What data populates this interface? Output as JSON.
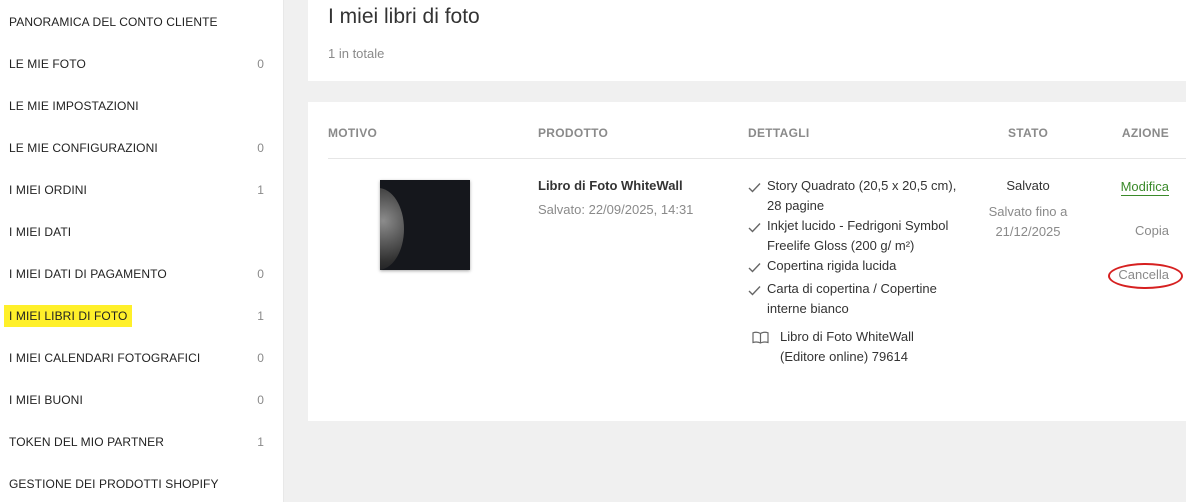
{
  "sidebar": {
    "items": [
      {
        "label": "PANORAMICA DEL CONTO CLIENTE",
        "count": ""
      },
      {
        "label": "LE MIE FOTO",
        "count": "0"
      },
      {
        "label": "LE MIE IMPOSTAZIONI",
        "count": ""
      },
      {
        "label": "LE MIE CONFIGURAZIONI",
        "count": "0"
      },
      {
        "label": "I MIEI ORDINI",
        "count": "1"
      },
      {
        "label": "I MIEI DATI",
        "count": ""
      },
      {
        "label": "I MIEI DATI DI PAGAMENTO",
        "count": "0"
      },
      {
        "label": "I MIEI LIBRI DI FOTO",
        "count": "1",
        "highlighted": true
      },
      {
        "label": "I MIEI CALENDARI FOTOGRAFICI",
        "count": "0"
      },
      {
        "label": "I MIEI BUONI",
        "count": "0"
      },
      {
        "label": "TOKEN DEL MIO PARTNER",
        "count": "1"
      },
      {
        "label": "GESTIONE DEI PRODOTTI SHOPIFY",
        "count": ""
      }
    ],
    "highlight_color": "#fff02a"
  },
  "header": {
    "title": "I miei libri di foto",
    "total": "1 in totale"
  },
  "table": {
    "columns": {
      "motivo": "MOTIVO",
      "prodotto": "PRODOTTO",
      "dettagli": "DETTAGLI",
      "stato": "STATO",
      "azione": "AZIONE"
    },
    "row": {
      "thumbnail_icon": "photo-thumbnail",
      "product_name": "Libro di Foto WhiteWall",
      "saved": "Salvato: 22/09/2025, 14:31",
      "details": [
        "Story Quadrato (20,5 x 20,5 cm), 28 pagine",
        "Inkjet lucido - Fedrigoni Symbol Freelife Gloss (200 g/ m²)",
        "Copertina rigida lucida",
        "Carta di copertina / Copertine interne bianco"
      ],
      "book_info": "Libro di Foto WhiteWall (Editore online) 79614",
      "status": "Salvato",
      "status_sub": "Salvato fino a 21/12/2025",
      "actions": {
        "edit": "Modifica",
        "copy": "Copia",
        "delete": "Cancella"
      }
    }
  },
  "colors": {
    "accent_green": "#3a8a2a",
    "annotation_red": "#d62020"
  }
}
